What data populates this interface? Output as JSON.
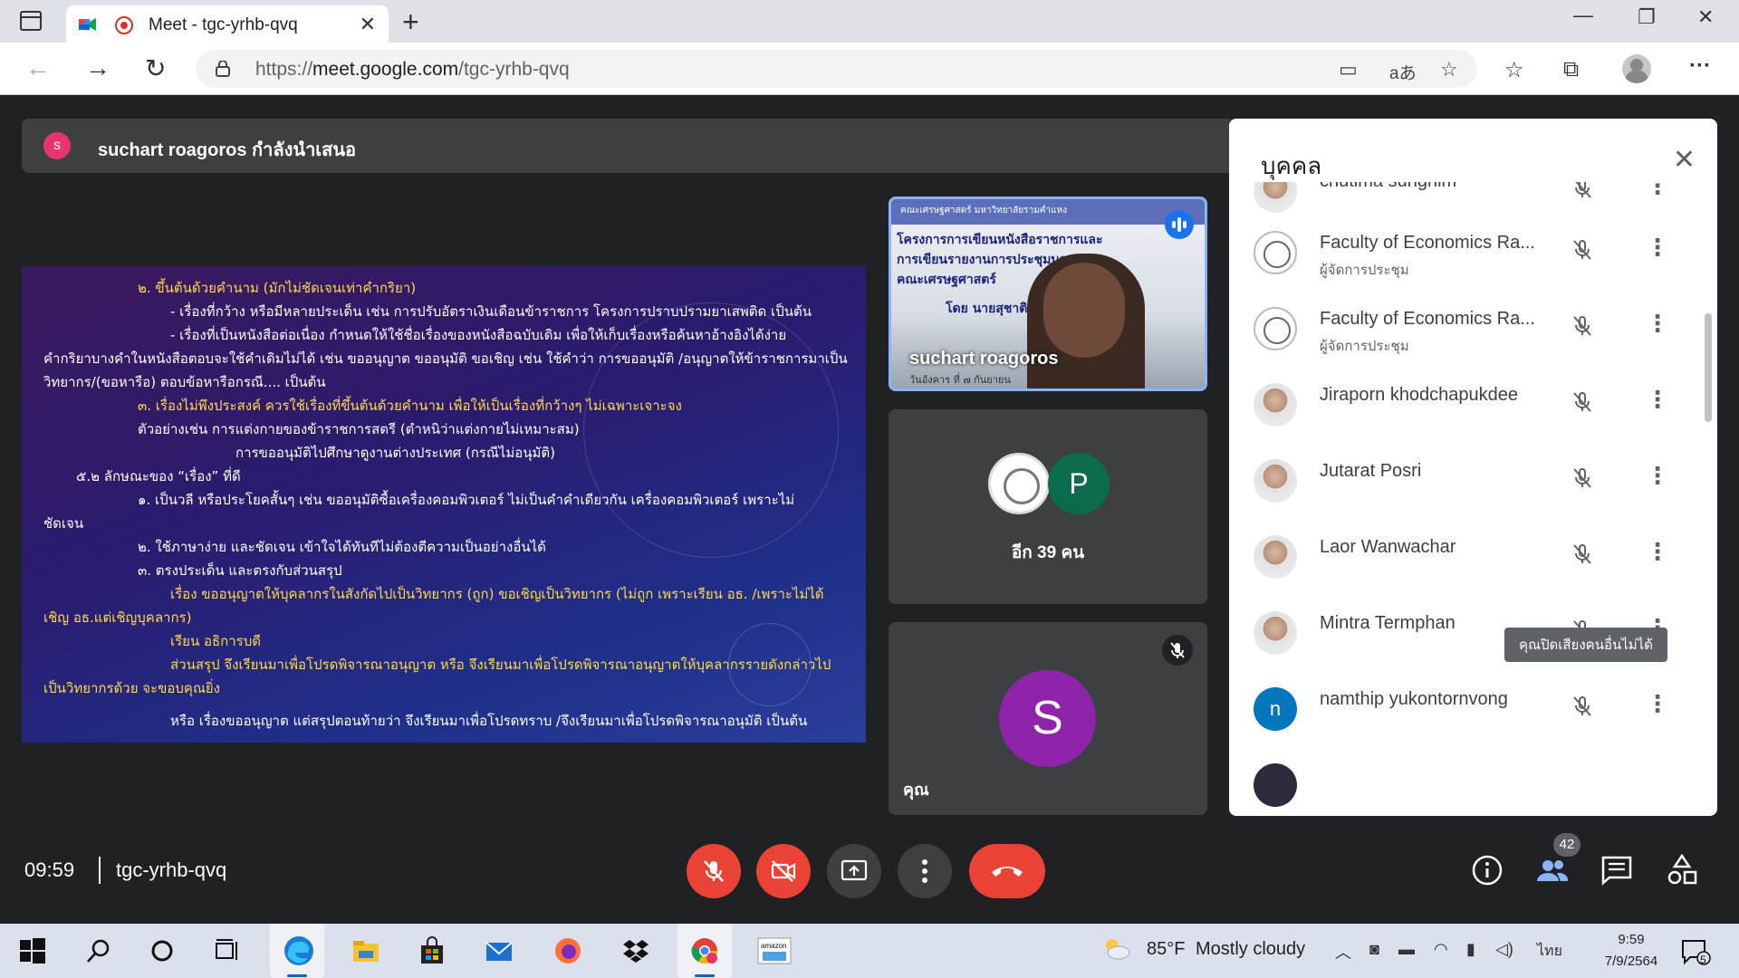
{
  "browser": {
    "tab_title": "Meet - tgc-yrhb-qvq",
    "url_prefix": "https://",
    "url_host": "meet.google.com",
    "url_path": "/tgc-yrhb-qvq"
  },
  "meet": {
    "presenter_initial": "s",
    "presenter_text": "suchart roagoros กำลังนำเสนอ",
    "tile_speaker_name": "suchart roagoros",
    "tile_more_initial": "P",
    "tile_more_label": "อีก 39 คน",
    "self_initial": "S",
    "self_label": "คุณ",
    "clock": "09:59",
    "meeting_code": "tgc-yrhb-qvq",
    "people_count": "42",
    "tooltip": "คุณปิดเสียงคนอื่นไม่ได้",
    "slide_lines": [
      "๒. ขึ้นต้นด้วยคำนาม (มักไม่ชัดเจนเท่าคำกริยา)",
      "- เรื่องที่กว้าง หรือมีหลายประเด็น เช่น การปรับอัตราเงินเดือนข้าราชการ โครงการปราบปรามยาเสพติด เป็นต้น",
      "- เรื่องที่เป็นหนังสือต่อเนื่อง กำหนดให้ใช้ชื่อเรื่องของหนังสือฉบับเดิม เพื่อให้เก็บเรื่องหรือค้นหาอ้างอิงได้ง่าย",
      "คำกริยาบางคำในหนังสือตอบจะใช้คำเดิมไม่ได้ เช่น ขออนุญาต ขออนุมัติ ขอเชิญ เช่น ใช้คำว่า การขออนุมัติ /อนุญาตให้ข้าราชการมาเป็น",
      "วิทยากร/(ขอหารือ) ตอบข้อหารือกรณี.... เป็นต้น",
      "๓. เรื่องไม่พึงประสงค์ ควรใช้เรื่องที่ขึ้นต้นด้วยคำนาม เพื่อให้เป็นเรื่องที่กว้างๆ ไม่เฉพาะเจาะจง",
      "ตัวอย่างเช่น        การแต่งกายของข้าราชการสตรี (ตำหนิว่าแต่งกายไม่เหมาะสม)",
      "การขออนุมัติไปศึกษาดูงานต่างประเทศ (กรณีไม่อนุมัติ)",
      "๕.๒ ลักษณะของ “เรื่อง” ที่ดี",
      "๑. เป็นวลี หรือประโยคสั้นๆ เช่น ขออนุมัติซื้อเครื่องคอมพิวเตอร์ ไม่เป็นคำคำเดียวกัน เครื่องคอมพิวเตอร์ เพราะไม่",
      "ชัดเจน",
      "๒. ใช้ภาษาง่าย และชัดเจน เข้าใจได้ทันทีไม่ต้องตีความเป็นอย่างอื่นได้",
      "๓. ตรงประเด็น และตรงกับส่วนสรุป",
      "เรื่อง ขออนุญาตให้บุคลากรในสังกัดไปเป็นวิทยากร (ถูก) ขอเชิญเป็นวิทยากร (ไม่ถูก เพราะเรียน อธ. /เพราะไม่ได้",
      "เชิญ อธ.แต่เชิญบุคลากร)",
      "เรียน อธิการบดี",
      "ส่วนสรุป จึงเรียนมาเพื่อโปรดพิจารณาอนุญาต หรือ จึงเรียนมาเพื่อโปรดพิจารณาอนุญาตให้บุคลากรรายดังกล่าวไป",
      "เป็นวิทยากรด้วย จะขอบคุณยิ่ง",
      "หรือ เรื่องขออนุญาต แต่สรุปตอนท้ายว่า จึงเรียนมาเพื่อโปรดทราบ /จึงเรียนมาเพื่อโปรดพิจารณาอนุมัติ เป็นต้น"
    ],
    "tile_photo_lines": [
      "คณะเศรษฐศาสตร์ มหาวิทยาลัยรามคำแหง",
      "โครงการการเขียนหนังสือราชการและ",
      "การเขียนรายงานการประชุมบุคลากร",
      "คณะเศรษฐศาสตร์",
      "โดย นายสุชาติ",
      "วันอังคาร ที่ ๗ กันยายน"
    ]
  },
  "people_panel": {
    "title": "บุคคล",
    "participants": [
      {
        "name": "chutima sungnim",
        "role": "",
        "avatar": "photo"
      },
      {
        "name": "Faculty of Economics Ra...",
        "role": "ผู้จัดการประชุม",
        "avatar": "seal"
      },
      {
        "name": "Faculty of Economics Ra...",
        "role": "ผู้จัดการประชุม",
        "avatar": "seal"
      },
      {
        "name": "Jiraporn khodchapukdee",
        "role": "",
        "avatar": "photo"
      },
      {
        "name": "Jutarat Posri",
        "role": "",
        "avatar": "photo"
      },
      {
        "name": "Laor Wanwachar",
        "role": "",
        "avatar": "photo"
      },
      {
        "name": "Mintra Termphan",
        "role": "",
        "avatar": "photo"
      },
      {
        "name": "namthip yukontornvong",
        "role": "",
        "avatar": "letter",
        "initial": "n"
      }
    ]
  },
  "taskbar": {
    "temperature": "85°F",
    "weather": "Mostly cloudy",
    "lang": "ไทย",
    "time": "9:59",
    "date": "7/9/2564",
    "notifications": "5"
  },
  "colors": {
    "accent": "#1a73e8",
    "danger": "#ea4335",
    "meet_bg": "#202124",
    "tile_bg": "#3c4043"
  }
}
